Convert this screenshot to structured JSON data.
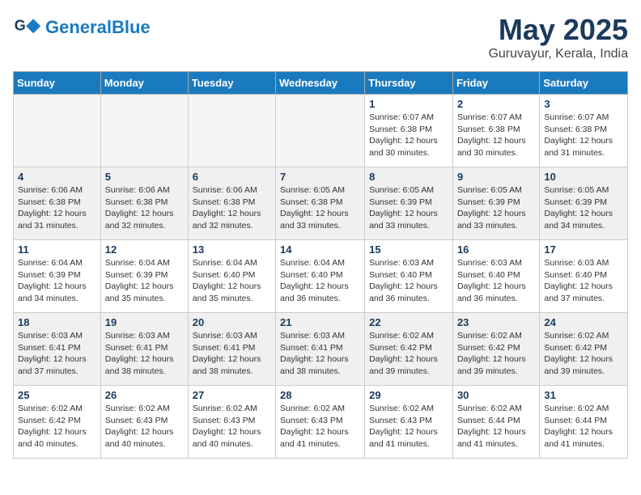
{
  "header": {
    "logo_line1": "General",
    "logo_line2": "Blue",
    "month": "May 2025",
    "location": "Guruvayur, Kerala, India"
  },
  "days_of_week": [
    "Sunday",
    "Monday",
    "Tuesday",
    "Wednesday",
    "Thursday",
    "Friday",
    "Saturday"
  ],
  "weeks": [
    [
      {
        "day": "",
        "empty": true
      },
      {
        "day": "",
        "empty": true
      },
      {
        "day": "",
        "empty": true
      },
      {
        "day": "",
        "empty": true
      },
      {
        "day": "1",
        "text": "Sunrise: 6:07 AM\nSunset: 6:38 PM\nDaylight: 12 hours\nand 30 minutes."
      },
      {
        "day": "2",
        "text": "Sunrise: 6:07 AM\nSunset: 6:38 PM\nDaylight: 12 hours\nand 30 minutes."
      },
      {
        "day": "3",
        "text": "Sunrise: 6:07 AM\nSunset: 6:38 PM\nDaylight: 12 hours\nand 31 minutes."
      }
    ],
    [
      {
        "day": "4",
        "text": "Sunrise: 6:06 AM\nSunset: 6:38 PM\nDaylight: 12 hours\nand 31 minutes."
      },
      {
        "day": "5",
        "text": "Sunrise: 6:06 AM\nSunset: 6:38 PM\nDaylight: 12 hours\nand 32 minutes."
      },
      {
        "day": "6",
        "text": "Sunrise: 6:06 AM\nSunset: 6:38 PM\nDaylight: 12 hours\nand 32 minutes."
      },
      {
        "day": "7",
        "text": "Sunrise: 6:05 AM\nSunset: 6:38 PM\nDaylight: 12 hours\nand 33 minutes."
      },
      {
        "day": "8",
        "text": "Sunrise: 6:05 AM\nSunset: 6:39 PM\nDaylight: 12 hours\nand 33 minutes."
      },
      {
        "day": "9",
        "text": "Sunrise: 6:05 AM\nSunset: 6:39 PM\nDaylight: 12 hours\nand 33 minutes."
      },
      {
        "day": "10",
        "text": "Sunrise: 6:05 AM\nSunset: 6:39 PM\nDaylight: 12 hours\nand 34 minutes."
      }
    ],
    [
      {
        "day": "11",
        "text": "Sunrise: 6:04 AM\nSunset: 6:39 PM\nDaylight: 12 hours\nand 34 minutes."
      },
      {
        "day": "12",
        "text": "Sunrise: 6:04 AM\nSunset: 6:39 PM\nDaylight: 12 hours\nand 35 minutes."
      },
      {
        "day": "13",
        "text": "Sunrise: 6:04 AM\nSunset: 6:40 PM\nDaylight: 12 hours\nand 35 minutes."
      },
      {
        "day": "14",
        "text": "Sunrise: 6:04 AM\nSunset: 6:40 PM\nDaylight: 12 hours\nand 36 minutes."
      },
      {
        "day": "15",
        "text": "Sunrise: 6:03 AM\nSunset: 6:40 PM\nDaylight: 12 hours\nand 36 minutes."
      },
      {
        "day": "16",
        "text": "Sunrise: 6:03 AM\nSunset: 6:40 PM\nDaylight: 12 hours\nand 36 minutes."
      },
      {
        "day": "17",
        "text": "Sunrise: 6:03 AM\nSunset: 6:40 PM\nDaylight: 12 hours\nand 37 minutes."
      }
    ],
    [
      {
        "day": "18",
        "text": "Sunrise: 6:03 AM\nSunset: 6:41 PM\nDaylight: 12 hours\nand 37 minutes."
      },
      {
        "day": "19",
        "text": "Sunrise: 6:03 AM\nSunset: 6:41 PM\nDaylight: 12 hours\nand 38 minutes."
      },
      {
        "day": "20",
        "text": "Sunrise: 6:03 AM\nSunset: 6:41 PM\nDaylight: 12 hours\nand 38 minutes."
      },
      {
        "day": "21",
        "text": "Sunrise: 6:03 AM\nSunset: 6:41 PM\nDaylight: 12 hours\nand 38 minutes."
      },
      {
        "day": "22",
        "text": "Sunrise: 6:02 AM\nSunset: 6:42 PM\nDaylight: 12 hours\nand 39 minutes."
      },
      {
        "day": "23",
        "text": "Sunrise: 6:02 AM\nSunset: 6:42 PM\nDaylight: 12 hours\nand 39 minutes."
      },
      {
        "day": "24",
        "text": "Sunrise: 6:02 AM\nSunset: 6:42 PM\nDaylight: 12 hours\nand 39 minutes."
      }
    ],
    [
      {
        "day": "25",
        "text": "Sunrise: 6:02 AM\nSunset: 6:42 PM\nDaylight: 12 hours\nand 40 minutes."
      },
      {
        "day": "26",
        "text": "Sunrise: 6:02 AM\nSunset: 6:43 PM\nDaylight: 12 hours\nand 40 minutes."
      },
      {
        "day": "27",
        "text": "Sunrise: 6:02 AM\nSunset: 6:43 PM\nDaylight: 12 hours\nand 40 minutes."
      },
      {
        "day": "28",
        "text": "Sunrise: 6:02 AM\nSunset: 6:43 PM\nDaylight: 12 hours\nand 41 minutes."
      },
      {
        "day": "29",
        "text": "Sunrise: 6:02 AM\nSunset: 6:43 PM\nDaylight: 12 hours\nand 41 minutes."
      },
      {
        "day": "30",
        "text": "Sunrise: 6:02 AM\nSunset: 6:44 PM\nDaylight: 12 hours\nand 41 minutes."
      },
      {
        "day": "31",
        "text": "Sunrise: 6:02 AM\nSunset: 6:44 PM\nDaylight: 12 hours\nand 41 minutes."
      }
    ]
  ]
}
